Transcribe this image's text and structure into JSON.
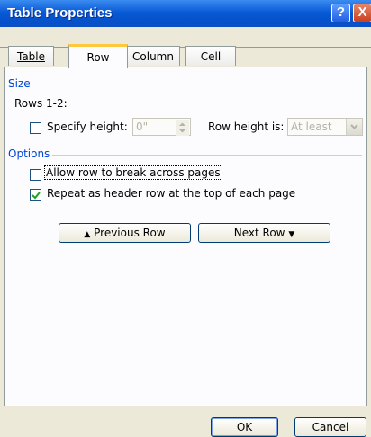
{
  "window": {
    "title": "Table Properties",
    "help_glyph": "?",
    "close_glyph": "X"
  },
  "tabs": [
    {
      "label": "Table",
      "underline": "T"
    },
    {
      "label": "Row",
      "underline": "R"
    },
    {
      "label": "Column",
      "underline": "u"
    },
    {
      "label": "Cell",
      "underline": "e"
    }
  ],
  "size": {
    "heading": "Size",
    "rows_label": "Rows 1-2:",
    "specify_height": {
      "label": "Specify height:",
      "checked": false
    },
    "height_value": "0\"",
    "row_height_is_label": "Row height is:",
    "row_height_is_value": "At least"
  },
  "options": {
    "heading": "Options",
    "allow_break": {
      "label": "Allow row to break across pages",
      "checked": false
    },
    "repeat_header": {
      "label": "Repeat as header row at the top of each page",
      "checked": true
    }
  },
  "nav": {
    "previous": "Previous Row",
    "next": "Next Row"
  },
  "footer": {
    "ok": "OK",
    "cancel": "Cancel"
  }
}
